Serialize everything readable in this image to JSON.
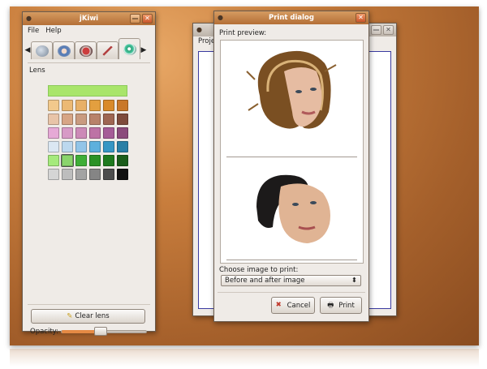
{
  "jkiwi": {
    "title": "jKiwi",
    "menu": {
      "file": "File",
      "help": "Help"
    },
    "panel_label": "Lens",
    "clear_button": "Clear lens",
    "opacity_label": "Opacity:",
    "opacity_value": 0.45,
    "tabs": [
      {
        "name": "hair",
        "icon": "hair-icon"
      },
      {
        "name": "skin",
        "icon": "pallet-icon"
      },
      {
        "name": "lips",
        "icon": "lips-icon"
      },
      {
        "name": "makeup",
        "icon": "brush-icon"
      },
      {
        "name": "lens",
        "icon": "lens-icon"
      }
    ],
    "highlight_color": "#a9e56b",
    "swatches": [
      [
        "#f2c98c",
        "#ecb974",
        "#e8b067",
        "#e39f3f",
        "#d98a2a",
        "#c9782a"
      ],
      [
        "#e8c4a8",
        "#d7a585",
        "#c99b80",
        "#b8826a",
        "#9e6652",
        "#7e4b3c"
      ],
      [
        "#e6a9d6",
        "#d79ac6",
        "#cc8ab7",
        "#bd72a5",
        "#a55c97",
        "#8b4b7c"
      ],
      [
        "#dbe7f2",
        "#bcd8ee",
        "#92c5e8",
        "#5eb0dd",
        "#3796c4",
        "#2a7fa6"
      ],
      [
        "#a5ea7c",
        "#8ad46c",
        "#3fae37",
        "#2b9226",
        "#1f7a1f",
        "#1b5d1b"
      ],
      [
        "#d5d5d5",
        "#bdbdbd",
        "#a3a3a3",
        "#858585",
        "#4d4d4d",
        "#121212"
      ]
    ]
  },
  "project": {
    "title": "",
    "menu": "Proje"
  },
  "print_dialog": {
    "title": "Print dialog",
    "preview_label": "Print preview:",
    "choose_label": "Choose image to print:",
    "selected_option": "Before and after image",
    "cancel": "Cancel",
    "print": "Print"
  }
}
